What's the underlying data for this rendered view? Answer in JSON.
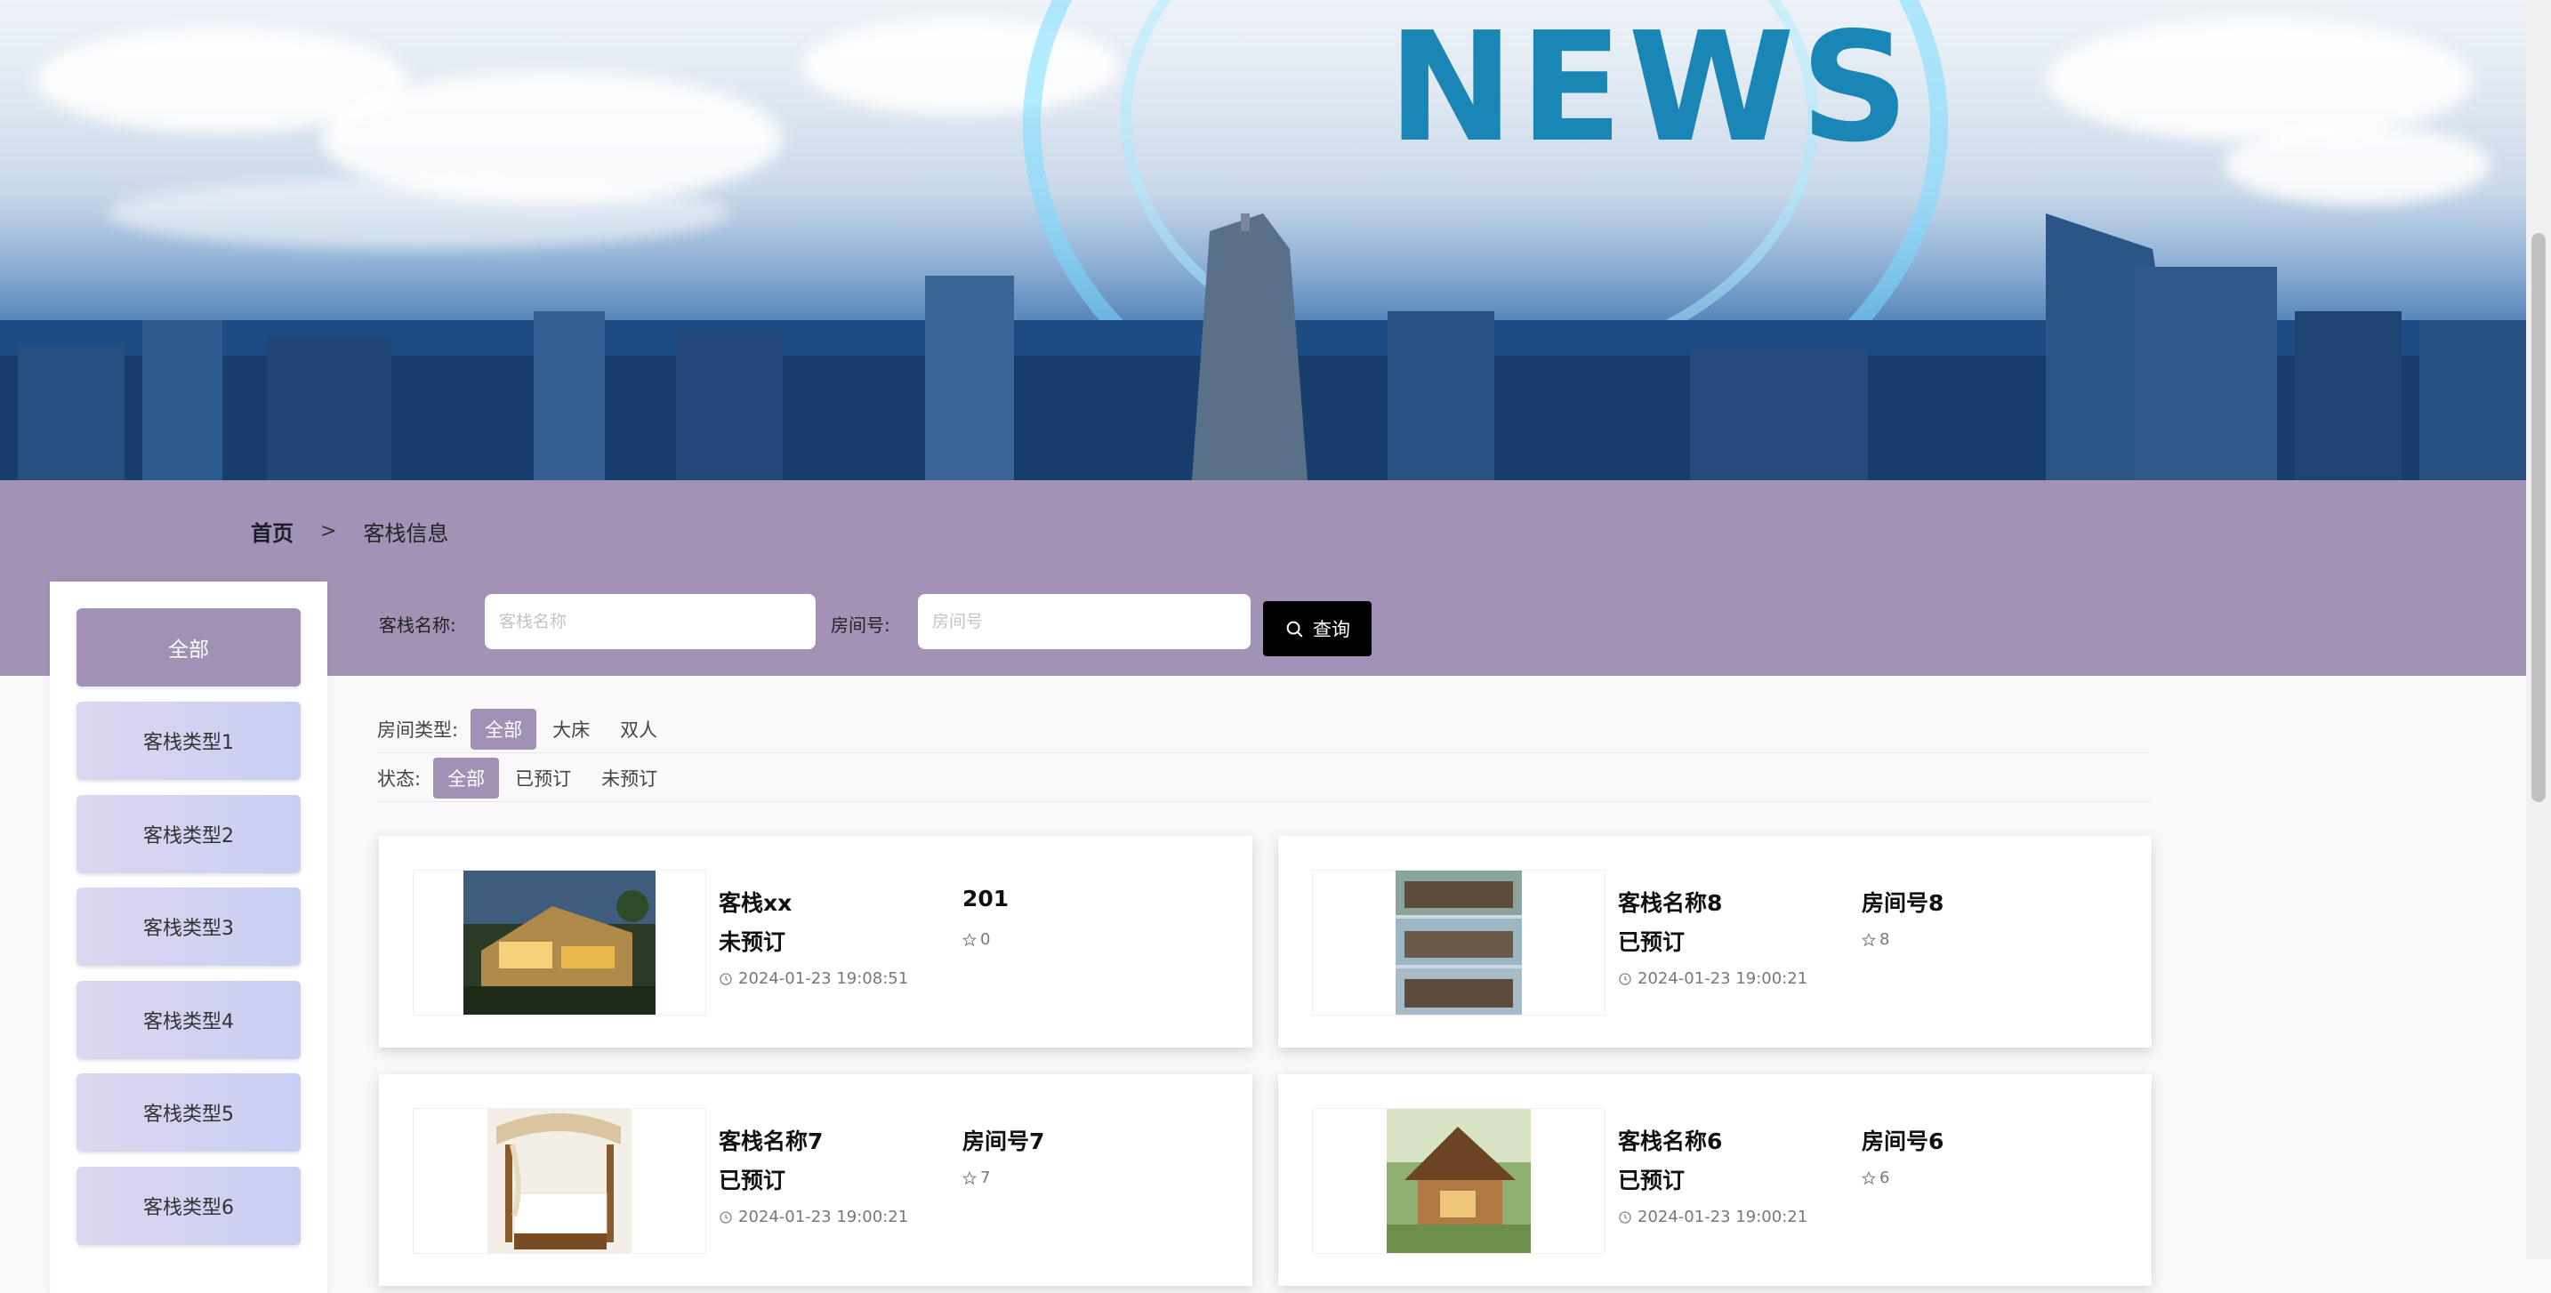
{
  "banner": {
    "title": "NEWS"
  },
  "breadcrumb": {
    "home": "首页",
    "separator": ">",
    "current": "客栈信息"
  },
  "sidebar": {
    "items": [
      {
        "label": "全部",
        "active": true
      },
      {
        "label": "客栈类型1"
      },
      {
        "label": "客栈类型2"
      },
      {
        "label": "客栈类型3"
      },
      {
        "label": "客栈类型4"
      },
      {
        "label": "客栈类型5"
      },
      {
        "label": "客栈类型6"
      }
    ]
  },
  "search": {
    "name_label": "客栈名称:",
    "name_placeholder": "客栈名称",
    "room_label": "房间号:",
    "room_placeholder": "房间号",
    "button_label": "查询",
    "button_icon": "search-icon"
  },
  "filters": {
    "room_type": {
      "label": "房间类型:",
      "options": [
        "全部",
        "大床",
        "双人"
      ],
      "selected": "全部"
    },
    "status": {
      "label": "状态:",
      "options": [
        "全部",
        "已预订",
        "未预订"
      ],
      "selected": "全部"
    }
  },
  "cards": [
    {
      "name": "客栈xx",
      "room": "201",
      "status": "未预订",
      "stars": "0",
      "time": "2024-01-23 19:08:51",
      "thumb": "night-villa"
    },
    {
      "name": "客栈名称8",
      "room": "房间号8",
      "status": "已预订",
      "stars": "8",
      "time": "2024-01-23 19:00:21",
      "thumb": "courtyard-house"
    },
    {
      "name": "客栈名称7",
      "room": "房间号7",
      "status": "已预订",
      "stars": "7",
      "time": "2024-01-23 19:00:21",
      "thumb": "canopy-bedroom"
    },
    {
      "name": "客栈名称6",
      "room": "房间号6",
      "status": "已预订",
      "stars": "6",
      "time": "2024-01-23 19:00:21",
      "thumb": "wooden-lodge"
    }
  ],
  "colors": {
    "accent": "#a091b5",
    "band": "#a293b6",
    "button": "#000000"
  }
}
